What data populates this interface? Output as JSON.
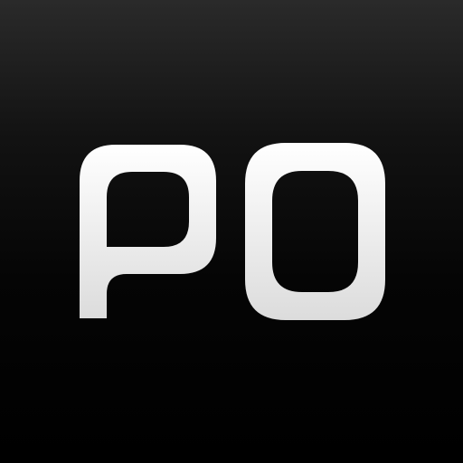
{
  "app_icon": {
    "logo_text": "PO",
    "colors": {
      "background_top": "#2a2a2a",
      "background_bottom": "#000000",
      "glyph_top": "#ffffff",
      "glyph_bottom": "#dcdcdc"
    }
  }
}
